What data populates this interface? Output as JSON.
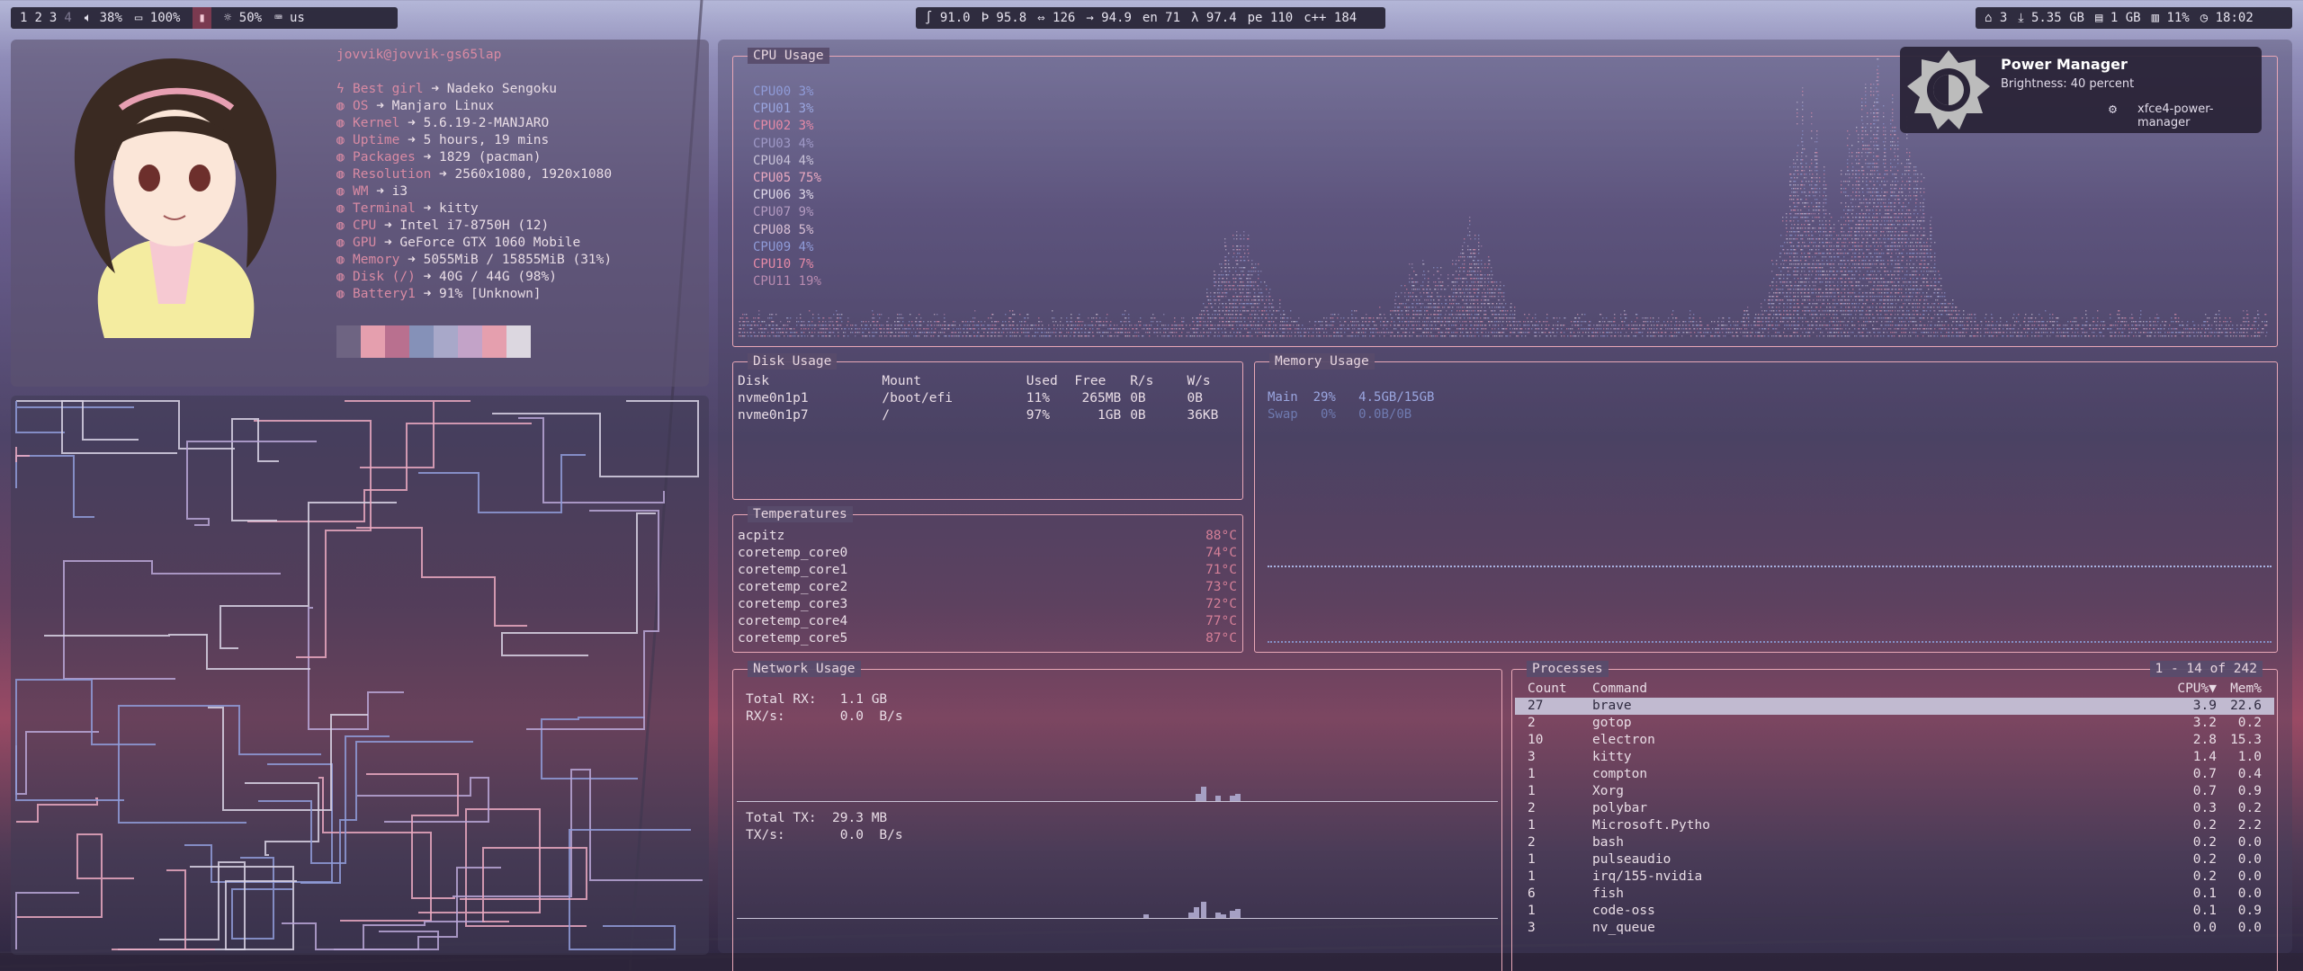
{
  "topbar": {
    "workspaces": [
      "1",
      "2",
      "3",
      "4"
    ],
    "volume": "38%",
    "battery": "100%",
    "brightness": "50%",
    "keyboard": "us"
  },
  "stats_bar": {
    "s1": "∫ 91.0",
    "s2": "Þ 95.8",
    "s3": "⇔ 126",
    "s4": "→ 94.9",
    "s5": "en 71",
    "s6": "λ 97.4",
    "s7": "pe 110",
    "s8": "c++ 184"
  },
  "right_bar": {
    "updates": "3",
    "download": "5.35 GB",
    "memory": "1 GB",
    "disk": "11%",
    "clock": "18:02"
  },
  "neofetch": {
    "header": "jovvik@jovvik-gs65lap",
    "rows": [
      {
        "key": "Best girl",
        "val": "Nadeko Sengoku"
      },
      {
        "key": "OS",
        "val": "Manjaro Linux"
      },
      {
        "key": "Kernel",
        "val": "5.6.19-2-MANJARO"
      },
      {
        "key": "Uptime",
        "val": "5 hours, 19 mins"
      },
      {
        "key": "Packages",
        "val": "1829 (pacman)"
      },
      {
        "key": "Resolution",
        "val": "2560x1080, 1920x1080"
      },
      {
        "key": "WM",
        "val": "i3"
      },
      {
        "key": "Terminal",
        "val": "kitty"
      },
      {
        "key": "CPU",
        "val": "Intel i7-8750H (12)"
      },
      {
        "key": "GPU",
        "val": "GeForce GTX 1060 Mobile"
      },
      {
        "key": "Memory",
        "val": "5055MiB / 15855MiB (31%)"
      },
      {
        "key": "Disk (/)",
        "val": "40G / 44G (98%)"
      },
      {
        "key": "Battery1",
        "val": "91% [Unknown]"
      }
    ],
    "arrow": "➜",
    "swatch_colors": [
      "#6e6482",
      "#e59fae",
      "#b9708f",
      "#8591b8",
      "#a8a8c9",
      "#c3a3c8",
      "#e59fae",
      "#dcd7e0"
    ]
  },
  "cpu": {
    "title": "CPU Usage",
    "cores": [
      {
        "label": "CPU00",
        "pct": "3%",
        "color": "#8f9bd8"
      },
      {
        "label": "CPU01",
        "pct": "3%",
        "color": "#9aa6e0"
      },
      {
        "label": "CPU02",
        "pct": "3%",
        "color": "#e58aa7"
      },
      {
        "label": "CPU03",
        "pct": "4%",
        "color": "#9e98c6"
      },
      {
        "label": "CPU04",
        "pct": "4%",
        "color": "#c8c2d8"
      },
      {
        "label": "CPU05",
        "pct": "75%",
        "color": "#e9a8c0"
      },
      {
        "label": "CPU06",
        "pct": "3%",
        "color": "#dfd8e8"
      },
      {
        "label": "CPU07",
        "pct": "9%",
        "color": "#b29ac0"
      },
      {
        "label": "CPU08",
        "pct": "5%",
        "color": "#d8bfd4"
      },
      {
        "label": "CPU09",
        "pct": "4%",
        "color": "#8f9bd8"
      },
      {
        "label": "CPU10",
        "pct": "7%",
        "color": "#e58aa7"
      },
      {
        "label": "CPU11",
        "pct": "19%",
        "color": "#b88bb0"
      }
    ]
  },
  "disk": {
    "title": "Disk Usage",
    "headers": [
      "Disk",
      "Mount",
      "Used",
      "Free",
      "R/s",
      "W/s"
    ],
    "rows": [
      [
        "nvme0n1p1",
        "/boot/efi",
        "11%",
        "265MB",
        "0B",
        "0B"
      ],
      [
        "nvme0n1p7",
        "/",
        "97%",
        "1GB",
        "0B",
        "36KB"
      ]
    ]
  },
  "memory": {
    "title": "Memory Usage",
    "main_label": "Main",
    "main_pct": "29%",
    "main_val": "4.5GB/15GB",
    "swap_label": "Swap",
    "swap_pct": "0%",
    "swap_val": "0.0B/0B"
  },
  "temps": {
    "title": "Temperatures",
    "rows": [
      {
        "name": "acpitz",
        "val": "88°C"
      },
      {
        "name": "coretemp_core0",
        "val": "74°C"
      },
      {
        "name": "coretemp_core1",
        "val": "71°C"
      },
      {
        "name": "coretemp_core2",
        "val": "73°C"
      },
      {
        "name": "coretemp_core3",
        "val": "72°C"
      },
      {
        "name": "coretemp_core4",
        "val": "77°C"
      },
      {
        "name": "coretemp_core5",
        "val": "87°C"
      }
    ]
  },
  "network": {
    "title": "Network Usage",
    "rx_total_label": "Total RX:",
    "rx_total": "1.1 GB",
    "rx_rate_label": "RX/s:",
    "rx_rate": "0.0  B/s",
    "tx_total_label": "Total TX:",
    "tx_total": "29.3 MB",
    "tx_rate_label": "TX/s:",
    "tx_rate": "0.0  B/s"
  },
  "processes": {
    "title": "Processes",
    "range": "1 - 14 of 242",
    "headers": [
      "Count",
      "Command",
      "CPU%▼",
      "Mem%"
    ],
    "rows": [
      [
        "27",
        "brave",
        "3.9",
        "22.6"
      ],
      [
        "2",
        "gotop",
        "3.2",
        "0.2"
      ],
      [
        "10",
        "electron",
        "2.8",
        "15.3"
      ],
      [
        "3",
        "kitty",
        "1.4",
        "1.0"
      ],
      [
        "1",
        "compton",
        "0.7",
        "0.4"
      ],
      [
        "1",
        "Xorg",
        "0.7",
        "0.9"
      ],
      [
        "2",
        "polybar",
        "0.3",
        "0.2"
      ],
      [
        "1",
        "Microsoft.Pytho",
        "0.2",
        "2.2"
      ],
      [
        "2",
        "bash",
        "0.2",
        "0.0"
      ],
      [
        "1",
        "pulseaudio",
        "0.2",
        "0.0"
      ],
      [
        "1",
        "irq/155-nvidia",
        "0.2",
        "0.0"
      ],
      [
        "6",
        "fish",
        "0.1",
        "0.0"
      ],
      [
        "1",
        "code-oss",
        "0.1",
        "0.9"
      ],
      [
        "3",
        "nv_queue",
        "0.0",
        "0.0"
      ]
    ]
  },
  "notification": {
    "title": "Power Manager",
    "body": "Brightness: 40 percent",
    "app": "xfce4-power-manager"
  }
}
